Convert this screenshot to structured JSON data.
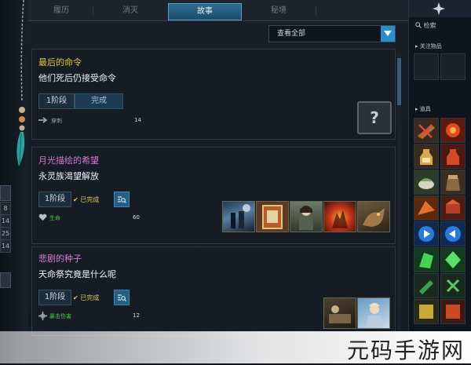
{
  "tabs": [
    {
      "label": "履历",
      "active": false
    },
    {
      "label": "消灭",
      "active": false
    },
    {
      "label": "故事",
      "active": true
    },
    {
      "label": "秘境",
      "active": false
    }
  ],
  "filter": {
    "label": "查看全部"
  },
  "left_strip": {
    "numbers": [
      "8",
      "14",
      "25",
      "14"
    ]
  },
  "quests": [
    {
      "title": "最后的命令",
      "title_color": "#e8c24a",
      "subtitle": "他们死后仍接受命令",
      "stage": "1阶段",
      "status": "完成",
      "reward_icon": "weapon-pierce-icon",
      "reward_label": "穿刺",
      "reward_value": "14",
      "reward_unknown": "?"
    },
    {
      "title": "月光描绘的希望",
      "title_color": "#d77ad6",
      "subtitle": "永灵族渴望解放",
      "stage": "1阶段",
      "status": "已完成",
      "reward_icon": "heart-icon",
      "reward_label": "生命",
      "reward_value": "60",
      "thumbnails": [
        "moonlit-figures",
        "tome-book",
        "armored-girl",
        "fire-creature",
        "beast-monster"
      ]
    },
    {
      "title": "悲剧的种子",
      "title_color": "#d77ad6",
      "subtitle": "天命祭究竟是什么呢",
      "stage": "1阶段",
      "status": "已完成",
      "reward_icon": "crosshair-icon",
      "reward_label": "暴击伤害",
      "reward_value": "12",
      "thumbnails": [
        "workshop-scene",
        "fairy-character"
      ]
    }
  ],
  "inventory": {
    "search_label": "检索",
    "follow_label": "关注物品",
    "items_label": "道具"
  },
  "watermark": "元码手游网",
  "colors": {
    "accent": "#2a8fc8",
    "title_gold": "#e8c24a",
    "title_purple": "#d77ad6",
    "reward_green": "#52c452"
  }
}
